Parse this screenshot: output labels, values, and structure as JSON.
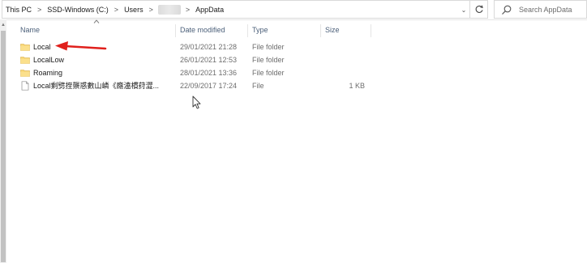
{
  "address_bar": {
    "crumbs": [
      "This PC",
      "SSD-Windows (C:)",
      "Users",
      "AppData"
    ],
    "separator": ">",
    "history_icon": "chevron-down-icon",
    "refresh_icon": "refresh-icon"
  },
  "search": {
    "placeholder": "Search AppData",
    "icon": "search-icon"
  },
  "columns": {
    "name": "Name",
    "date": "Date modified",
    "type": "Type",
    "size": "Size",
    "sort_indicator": "^"
  },
  "files": [
    {
      "name": "Local",
      "date": "29/01/2021 21:28",
      "type": "File folder",
      "size": "",
      "icon": "folder-icon"
    },
    {
      "name": "LocalLow",
      "date": "26/01/2021 12:53",
      "type": "File folder",
      "size": "",
      "icon": "folder-icon"
    },
    {
      "name": "Roaming",
      "date": "28/01/2021 13:36",
      "type": "File folder",
      "size": "",
      "icon": "folder-icon"
    },
    {
      "name": "Local剩劈挃龒惑數山嶙《廕溘樌荮澀...",
      "date": "22/09/2017 17:24",
      "type": "File",
      "size": "1 KB",
      "icon": "file-icon"
    }
  ],
  "colors": {
    "folder": "#f8d775",
    "annotation_arrow": "#e0201c",
    "header_text": "#4c607a",
    "secondary_text": "#6d6d6d"
  }
}
